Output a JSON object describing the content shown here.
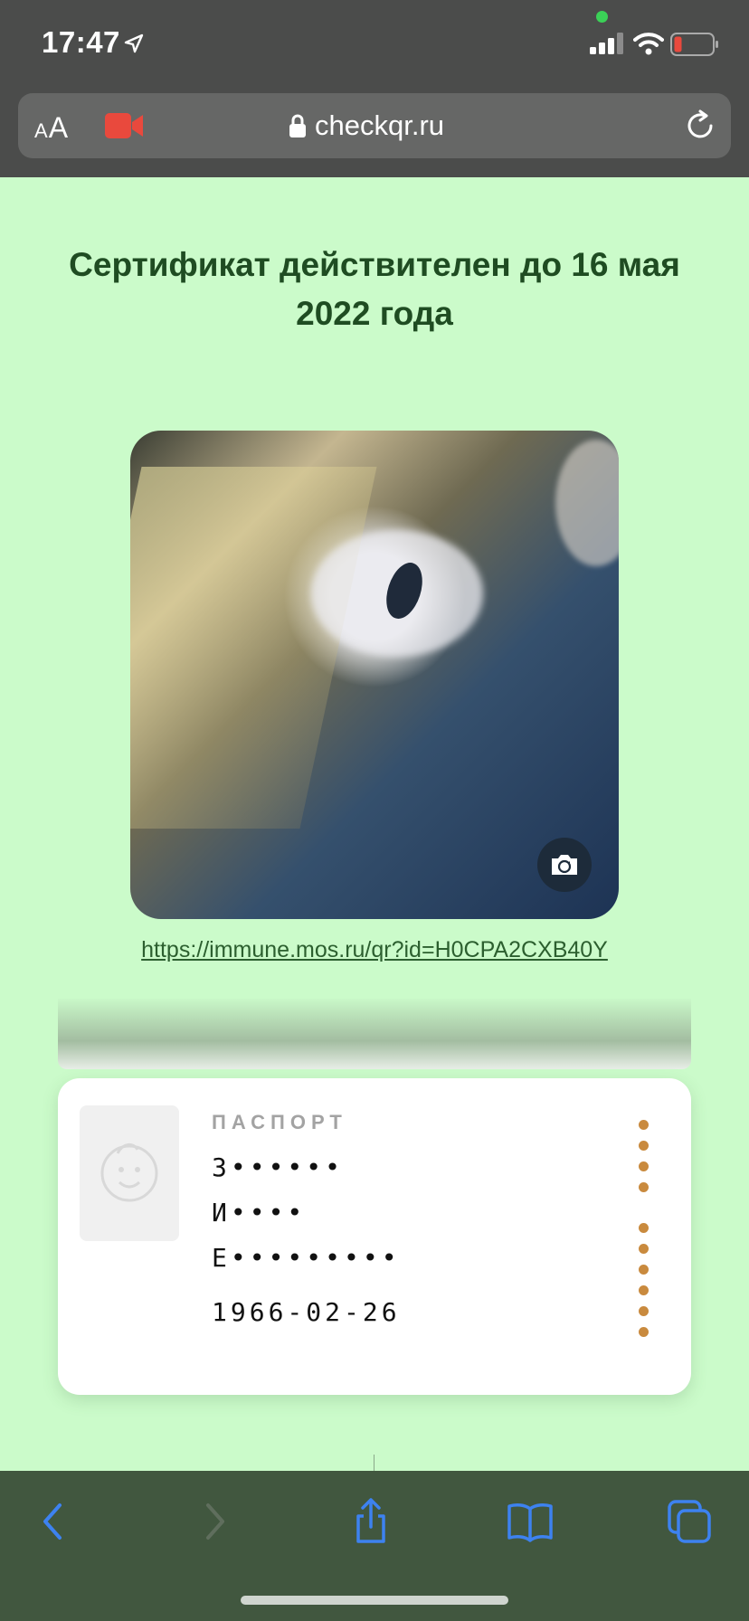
{
  "status_bar": {
    "time": "17:47",
    "icons": [
      "location-arrow-icon",
      "signal-icon",
      "wifi-icon",
      "battery-low-icon"
    ],
    "privacy_indicator_color": "#3bd157"
  },
  "address_bar": {
    "text_size_label_small": "A",
    "text_size_label_large": "A",
    "url": "checkqr.ru",
    "icons": [
      "video-recording-icon",
      "lock-icon",
      "reload-icon"
    ],
    "recording_color": "#e9493d"
  },
  "certificate": {
    "title": "Сертификат действителен до 16 мая 2022 года",
    "qr_link": "https://immune.mos.ru/qr?id=H0CPA2CXB40Y"
  },
  "passport_card": {
    "label": "ПАСПОРТ",
    "surname": "З••••••",
    "name": "И••••",
    "patronymic": "Е•••••••••",
    "birth_date": "1966-02-26"
  },
  "colors": {
    "page_background": "#cbfbca",
    "title_color": "#1f4c22",
    "dot_accent": "#c98a3e",
    "toolbar": "#41573f",
    "toolbar_icon": "#3d82f0"
  },
  "toolbar": {
    "buttons": [
      "back-icon",
      "forward-icon",
      "share-icon",
      "bookmarks-icon",
      "tabs-icon"
    ]
  }
}
